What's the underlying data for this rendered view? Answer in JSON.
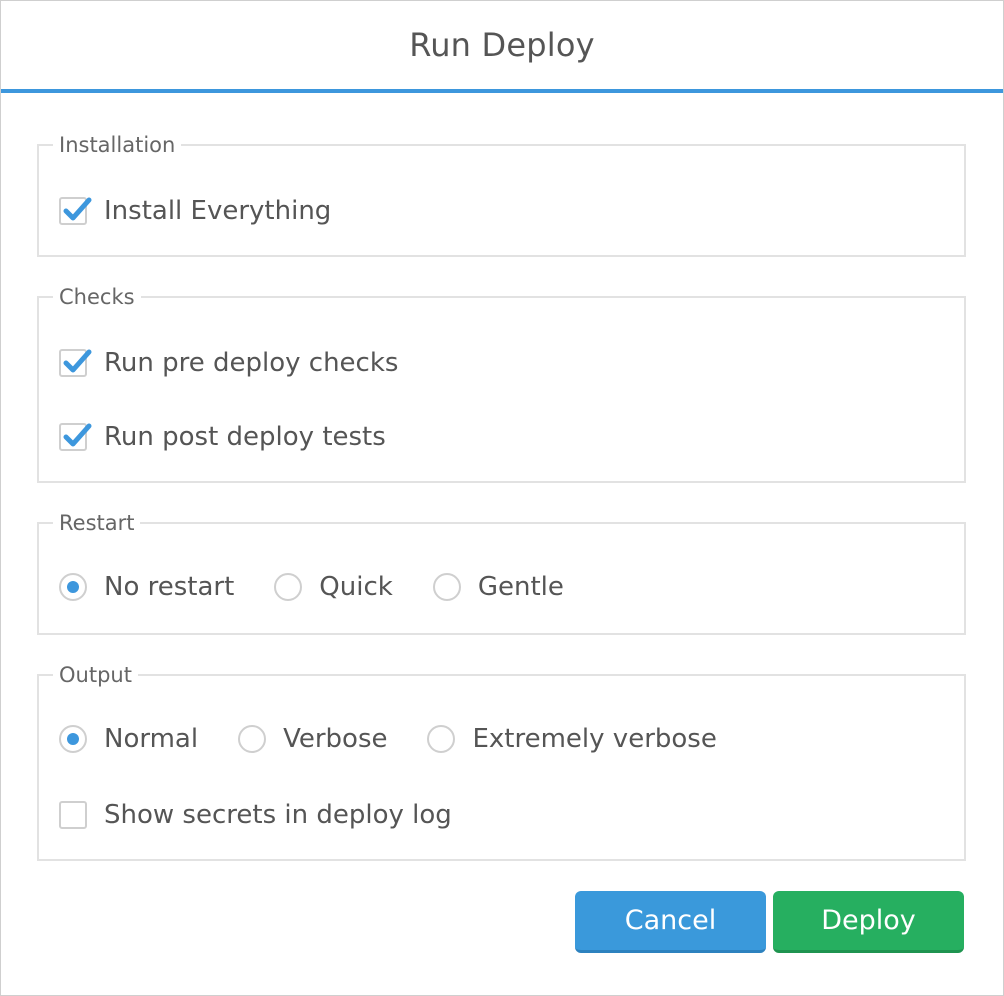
{
  "dialog": {
    "title": "Run Deploy"
  },
  "colors": {
    "accent": "#3d97dd",
    "cancel_button": "#3a99db",
    "deploy_button": "#26af60"
  },
  "installation": {
    "legend": "Installation",
    "install_everything": {
      "label": "Install Everything",
      "checked": true
    }
  },
  "checks": {
    "legend": "Checks",
    "pre_deploy": {
      "label": "Run pre deploy checks",
      "checked": true
    },
    "post_deploy": {
      "label": "Run post deploy tests",
      "checked": true
    }
  },
  "restart": {
    "legend": "Restart",
    "selected": "No restart",
    "options": [
      {
        "label": "No restart",
        "selected": true
      },
      {
        "label": "Quick",
        "selected": false
      },
      {
        "label": "Gentle",
        "selected": false
      }
    ]
  },
  "output": {
    "legend": "Output",
    "selected": "Normal",
    "options": [
      {
        "label": "Normal",
        "selected": true
      },
      {
        "label": "Verbose",
        "selected": false
      },
      {
        "label": "Extremely verbose",
        "selected": false
      }
    ],
    "show_secrets": {
      "label": "Show secrets in deploy log",
      "checked": false
    }
  },
  "footer": {
    "cancel_label": "Cancel",
    "deploy_label": "Deploy"
  },
  "icons": {
    "checkmark": "checkmark-icon"
  }
}
